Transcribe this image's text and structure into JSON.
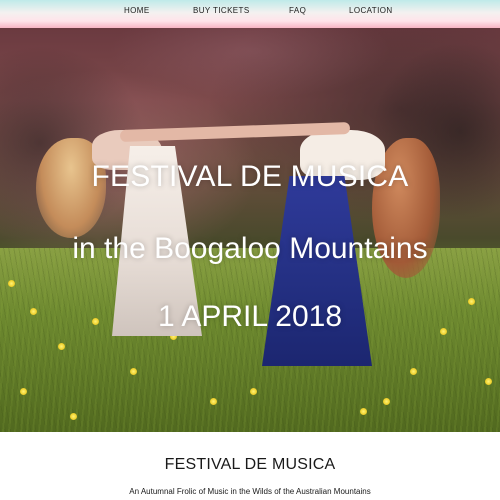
{
  "nav": {
    "home": "HOME",
    "buy_tickets": "BUY TICKETS",
    "faq": "FAQ",
    "location": "LOCATION"
  },
  "hero": {
    "title": "FESTIVAL DE MUSICA",
    "subtitle": "in the Boogaloo Mountains",
    "date": "1 APRIL 2018"
  },
  "content": {
    "title": "FESTIVAL DE MUSICA",
    "tagline": "An Autumnal Frolic of Music in the Wilds of the Australian Mountains"
  }
}
